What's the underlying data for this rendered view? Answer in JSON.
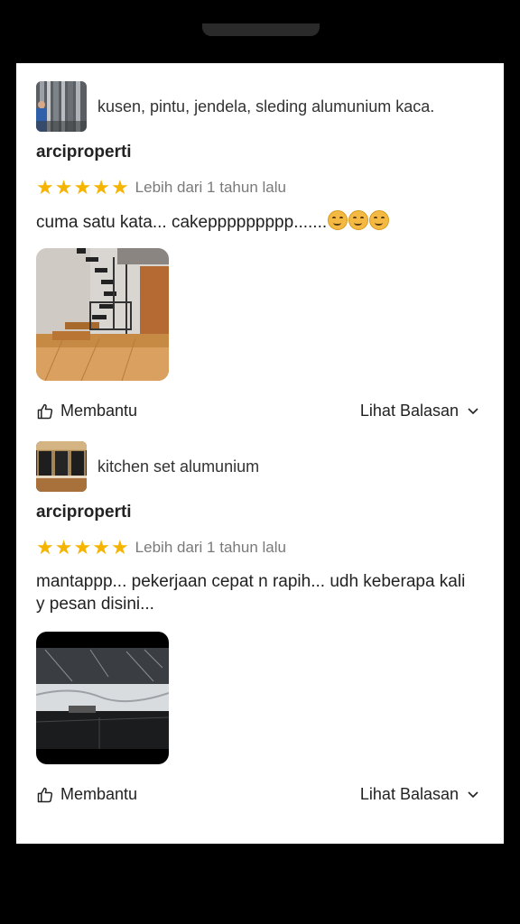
{
  "reviews": [
    {
      "product_name": "kusen, pintu, jendela, sleding alumunium kaca.",
      "username": "arciproperti",
      "rating": 5,
      "time": "Lebih dari 1 tahun lalu",
      "text": "cuma satu kata... cakeppppppppp.......",
      "emoji_count": 3,
      "helpful_label": "Membantu",
      "replies_label": "Lihat Balasan"
    },
    {
      "product_name": "kitchen set alumunium",
      "username": "arciproperti",
      "rating": 5,
      "time": "Lebih dari 1 tahun lalu",
      "text": "mantappp... pekerjaan cepat n rapih... udh keberapa kali y pesan disini...",
      "helpful_label": "Membantu",
      "replies_label": "Lihat Balasan"
    }
  ],
  "colors": {
    "star": "#f5b400",
    "frame": "#000000",
    "card": "#ffffff"
  },
  "icons": {
    "helpful": "thumbs-up-icon",
    "expand": "chevron-down-icon",
    "rating": "star-icon"
  }
}
